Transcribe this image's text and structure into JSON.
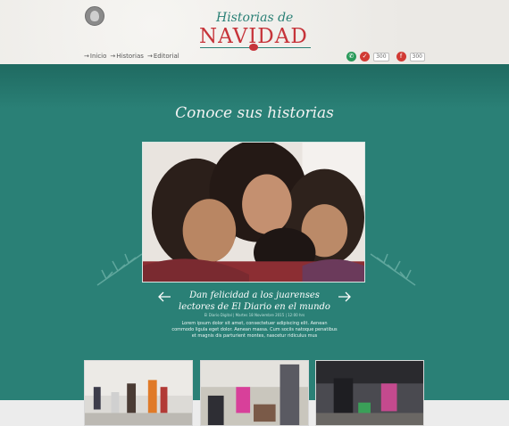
{
  "header": {
    "logo_top": "Historias de",
    "logo_main": "NAVIDAD"
  },
  "nav": {
    "items": [
      {
        "label": "Inicio"
      },
      {
        "label": "Historias"
      },
      {
        "label": "Editorial"
      }
    ],
    "arrow": "→"
  },
  "social": {
    "whatsapp_icon": "whatsapp-icon",
    "twitter_icon": "twitter-icon",
    "twitter_count": "300",
    "facebook_icon": "facebook-icon",
    "facebook_count": "300"
  },
  "main": {
    "title": "Conoce sus historias"
  },
  "slider": {
    "headline": "Dan felicidad a los juarenses lectores de El Diario en el mundo",
    "meta": "El Diario Digital | Martes 18 Noviembre 2015 | 12:00 hrs",
    "body": "Lorem ipsum dolor sit amet, consectetuer adipiscing elit. Aenean commodo ligula eget dolor. Aenean massa. Cum sociis natoque penatibus et magnis dis parturient montes, nascetur ridiculus mus"
  },
  "colors": {
    "teal": "#2a8076",
    "red": "#c6343a",
    "header_bg": "#efeeeb"
  }
}
